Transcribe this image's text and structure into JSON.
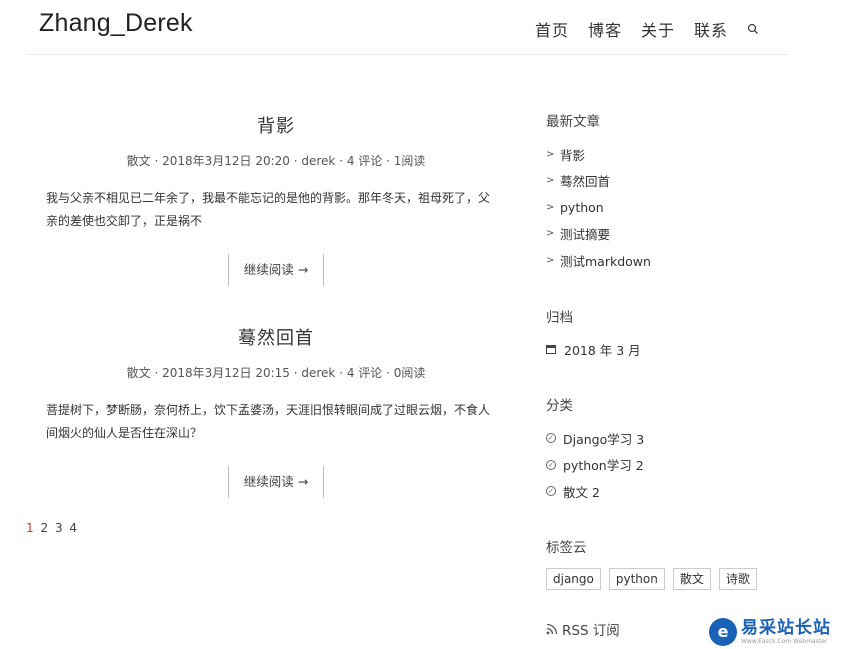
{
  "header": {
    "brand": "Zhang_Derek",
    "nav": [
      "首页",
      "博客",
      "关于",
      "联系"
    ]
  },
  "posts": [
    {
      "title": "背影",
      "category": "散文",
      "date": "2018年3月12日 20:20",
      "author": "derek",
      "comments": "4 评论",
      "reads": "1阅读",
      "excerpt": "我与父亲不相见已二年余了，我最不能忘记的是他的背影。那年冬天，祖母死了，父亲的差使也交卸了，正是祸不",
      "more": "继续阅读 →"
    },
    {
      "title": "蓦然回首",
      "category": "散文",
      "date": "2018年3月12日 20:15",
      "author": "derek",
      "comments": "4 评论",
      "reads": "0阅读",
      "excerpt": "菩提树下，梦断肠，奈何桥上，饮下孟婆汤，天涯旧恨转眼间成了过眼云烟，不食人间烟火的仙人是否住在深山？",
      "more": "继续阅读 →"
    }
  ],
  "pagination": [
    "1",
    "2",
    "3",
    "4"
  ],
  "sidebar": {
    "recent_title": "最新文章",
    "recent": [
      "背影",
      "蓦然回首",
      "python",
      "测试摘要",
      "测试markdown"
    ],
    "archive_title": "归档",
    "archive": [
      "2018 年 3 月"
    ],
    "category_title": "分类",
    "categories": [
      "Django学习 3",
      "python学习 2",
      "散文 2"
    ],
    "tags_title": "标签云",
    "tags": [
      "django",
      "python",
      "散文",
      "诗歌"
    ],
    "rss": "RSS 订阅"
  },
  "watermark": {
    "main": "易采站长站",
    "sub": "Www.Easck.Com Webmaster"
  },
  "colors": {
    "active_page": "#e03131",
    "watermark_blue": "#1a62b8"
  }
}
